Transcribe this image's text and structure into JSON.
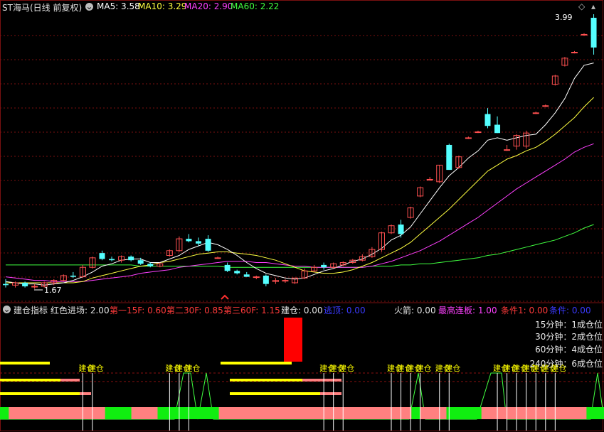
{
  "header": {
    "stock_name": "ST海马(日线 前复权)",
    "ma5_label": "MA5: 3.58",
    "ma10_label": "MA10: 3.29",
    "ma20_label": "MA20: 2.90",
    "ma60_label": "MA60: 2.22",
    "colors": {
      "ma5": "#ffffff",
      "ma10": "#ffff40",
      "ma20": "#ff40ff",
      "ma60": "#40ff40"
    }
  },
  "price_chart": {
    "high_label": "3.99",
    "low_label": "1.67",
    "up_color": "#ff5050",
    "down_color": "#54ffff",
    "candles": [
      [
        1.72,
        1.76,
        1.69,
        1.71
      ],
      [
        1.71,
        1.74,
        1.69,
        1.73
      ],
      [
        1.73,
        1.74,
        1.69,
        1.7
      ],
      [
        1.7,
        1.72,
        1.68,
        1.7
      ],
      [
        1.7,
        1.74,
        1.69,
        1.73
      ],
      [
        1.73,
        1.76,
        1.71,
        1.75
      ],
      [
        1.75,
        1.8,
        1.74,
        1.79
      ],
      [
        1.79,
        1.82,
        1.77,
        1.78
      ],
      [
        1.78,
        1.88,
        1.77,
        1.86
      ],
      [
        1.86,
        1.95,
        1.85,
        1.94
      ],
      [
        1.98,
        2.0,
        1.92,
        1.93
      ],
      [
        1.93,
        1.95,
        1.91,
        1.92
      ],
      [
        1.92,
        1.96,
        1.9,
        1.95
      ],
      [
        1.95,
        1.96,
        1.91,
        1.92
      ],
      [
        1.92,
        1.94,
        1.88,
        1.89
      ],
      [
        1.89,
        1.9,
        1.86,
        1.87
      ],
      [
        1.87,
        1.9,
        1.86,
        1.89
      ],
      [
        1.96,
        2.01,
        1.95,
        2.0
      ],
      [
        2.0,
        2.12,
        1.99,
        2.1
      ],
      [
        2.1,
        2.14,
        2.07,
        2.08
      ],
      [
        2.08,
        2.11,
        2.04,
        2.06
      ],
      [
        2.1,
        2.13,
        1.99,
        2.0
      ],
      [
        1.94,
        1.95,
        1.93,
        1.94
      ],
      [
        1.88,
        1.9,
        1.82,
        1.83
      ],
      [
        1.83,
        1.84,
        1.8,
        1.81
      ],
      [
        1.8,
        1.82,
        1.78,
        1.78
      ],
      [
        1.78,
        1.79,
        1.76,
        1.78
      ],
      [
        1.79,
        1.8,
        1.7,
        1.72
      ],
      [
        1.74,
        1.77,
        1.72,
        1.75
      ],
      [
        1.75,
        1.76,
        1.73,
        1.75
      ],
      [
        1.73,
        1.77,
        1.72,
        1.77
      ],
      [
        1.77,
        1.85,
        1.76,
        1.83
      ],
      [
        1.83,
        1.88,
        1.82,
        1.86
      ],
      [
        1.88,
        1.9,
        1.84,
        1.86
      ],
      [
        1.86,
        1.9,
        1.85,
        1.89
      ],
      [
        1.88,
        1.91,
        1.87,
        1.9
      ],
      [
        1.9,
        1.93,
        1.89,
        1.92
      ],
      [
        1.92,
        1.97,
        1.91,
        1.95
      ],
      [
        1.95,
        2.03,
        1.94,
        2.01
      ],
      [
        2.01,
        2.16,
        1.99,
        2.15
      ],
      [
        2.15,
        2.22,
        2.14,
        2.21
      ],
      [
        2.22,
        2.26,
        2.11,
        2.14
      ],
      [
        2.28,
        2.37,
        2.27,
        2.36
      ],
      [
        2.46,
        2.54,
        2.45,
        2.53
      ],
      [
        2.6,
        2.62,
        2.59,
        2.6
      ],
      [
        2.58,
        2.72,
        2.57,
        2.72
      ],
      [
        2.89,
        2.9,
        2.68,
        2.68
      ],
      [
        2.7,
        2.8,
        2.69,
        2.79
      ],
      [
        2.95,
        2.96,
        2.94,
        2.95
      ],
      [
        3.0,
        3.01,
        2.99,
        3.0
      ],
      [
        3.15,
        3.2,
        3.03,
        3.05
      ],
      [
        3.06,
        3.13,
        2.99,
        2.99
      ],
      [
        2.85,
        2.89,
        2.84,
        2.85
      ],
      [
        2.88,
        2.98,
        2.85,
        2.97
      ],
      [
        2.88,
        3.01,
        2.86,
        2.99
      ],
      [
        3.16,
        3.17,
        3.15,
        3.16
      ],
      [
        3.22,
        3.23,
        3.21,
        3.22
      ],
      [
        3.4,
        3.48,
        3.39,
        3.47
      ],
      [
        3.56,
        3.63,
        3.55,
        3.62
      ],
      [
        3.67,
        3.68,
        3.66,
        3.67
      ],
      [
        3.82,
        3.83,
        3.81,
        3.82
      ],
      [
        3.96,
        3.99,
        3.65,
        3.71
      ]
    ],
    "ma5": [
      1.74,
      1.73,
      1.72,
      1.72,
      1.71,
      1.72,
      1.73,
      1.75,
      1.78,
      1.82,
      1.87,
      1.89,
      1.92,
      1.93,
      1.93,
      1.9,
      1.9,
      1.93,
      1.96,
      2.01,
      2.04,
      2.07,
      2.05,
      2.01,
      1.96,
      1.9,
      1.85,
      1.81,
      1.79,
      1.77,
      1.76,
      1.77,
      1.8,
      1.83,
      1.85,
      1.88,
      1.91,
      1.93,
      1.97,
      2.02,
      2.09,
      2.13,
      2.2,
      2.31,
      2.42,
      2.53,
      2.63,
      2.7,
      2.78,
      2.84,
      2.93,
      2.95,
      2.93,
      2.95,
      2.97,
      2.98,
      3.06,
      3.16,
      3.28,
      3.45,
      3.56,
      3.58
    ],
    "ma10": [
      1.73,
      1.73,
      1.73,
      1.73,
      1.73,
      1.73,
      1.73,
      1.73,
      1.74,
      1.77,
      1.79,
      1.81,
      1.83,
      1.85,
      1.87,
      1.88,
      1.9,
      1.91,
      1.93,
      1.95,
      1.97,
      1.98,
      1.99,
      1.99,
      1.98,
      1.97,
      1.96,
      1.94,
      1.92,
      1.89,
      1.86,
      1.83,
      1.82,
      1.81,
      1.81,
      1.82,
      1.84,
      1.87,
      1.9,
      1.94,
      1.98,
      2.02,
      2.07,
      2.14,
      2.21,
      2.28,
      2.35,
      2.43,
      2.51,
      2.59,
      2.67,
      2.72,
      2.77,
      2.8,
      2.84,
      2.87,
      2.92,
      2.98,
      3.05,
      3.12,
      3.21,
      3.29
    ],
    "ma20": [
      1.78,
      1.77,
      1.76,
      1.75,
      1.75,
      1.74,
      1.74,
      1.74,
      1.74,
      1.75,
      1.76,
      1.77,
      1.78,
      1.79,
      1.81,
      1.82,
      1.83,
      1.84,
      1.86,
      1.87,
      1.88,
      1.89,
      1.9,
      1.91,
      1.91,
      1.91,
      1.9,
      1.9,
      1.89,
      1.88,
      1.87,
      1.87,
      1.86,
      1.86,
      1.86,
      1.86,
      1.86,
      1.86,
      1.87,
      1.89,
      1.91,
      1.94,
      1.97,
      2.0,
      2.04,
      2.08,
      2.13,
      2.18,
      2.23,
      2.28,
      2.34,
      2.4,
      2.46,
      2.52,
      2.57,
      2.62,
      2.67,
      2.72,
      2.77,
      2.83,
      2.87,
      2.9
    ],
    "ma60": [
      1.88,
      1.88,
      1.88,
      1.88,
      1.88,
      1.88,
      1.88,
      1.88,
      1.88,
      1.88,
      1.88,
      1.88,
      1.88,
      1.88,
      1.87,
      1.87,
      1.87,
      1.87,
      1.87,
      1.87,
      1.87,
      1.87,
      1.87,
      1.86,
      1.86,
      1.86,
      1.86,
      1.86,
      1.86,
      1.86,
      1.86,
      1.86,
      1.86,
      1.86,
      1.86,
      1.86,
      1.86,
      1.86,
      1.87,
      1.87,
      1.87,
      1.88,
      1.88,
      1.89,
      1.89,
      1.9,
      1.91,
      1.92,
      1.93,
      1.94,
      1.96,
      1.97,
      1.99,
      2.01,
      2.03,
      2.05,
      2.07,
      2.09,
      2.12,
      2.15,
      2.19,
      2.22
    ]
  },
  "indicator": {
    "name": "建仓指标",
    "red_entry": "红色进场: 2.00",
    "first_15f": "第一15F: 0.60",
    "second_30f": "第二30F: 0.85",
    "third_60f": "第三60F: 1.15",
    "build_pos": "建仓: 0.00",
    "escape": "逃顶: 0.00",
    "rocket": "火箭: 0.00",
    "max_limit": "最高连板: 1.00",
    "cond1": "条件1: 0.00",
    "cond2": "条件: 0.00",
    "pos_15": "15分钟：1成仓位",
    "pos_30": "30分钟：2成仓位",
    "pos_60": "60分钟：4成仓位",
    "pos_240": "240分钟：6成仓位",
    "signal_char": "建仓",
    "status_strip": [
      "g",
      "p",
      "p",
      "p",
      "p",
      "p",
      "p",
      "p",
      "p",
      "p",
      "p",
      "p",
      "g",
      "g",
      "g",
      "p",
      "p",
      "p",
      "g",
      "g",
      "g",
      "g",
      "g",
      "g",
      "g",
      "p",
      "p",
      "p",
      "p",
      "p",
      "p",
      "p",
      "p",
      "p",
      "p",
      "p",
      "p",
      "p",
      "p",
      "p",
      "p",
      "p",
      "p",
      "p",
      "p",
      "p",
      "p",
      "g",
      "p",
      "p",
      "p",
      "g",
      "g",
      "g",
      "g",
      "p",
      "p",
      "p",
      "p",
      "p",
      "p",
      "p",
      "p",
      "p",
      "p",
      "p",
      "p",
      "g",
      "g"
    ],
    "signals": [
      8,
      9,
      17,
      18,
      19,
      33,
      34,
      35,
      40,
      41,
      42,
      43,
      45,
      46,
      51,
      52,
      53,
      54,
      55,
      56,
      57
    ]
  }
}
